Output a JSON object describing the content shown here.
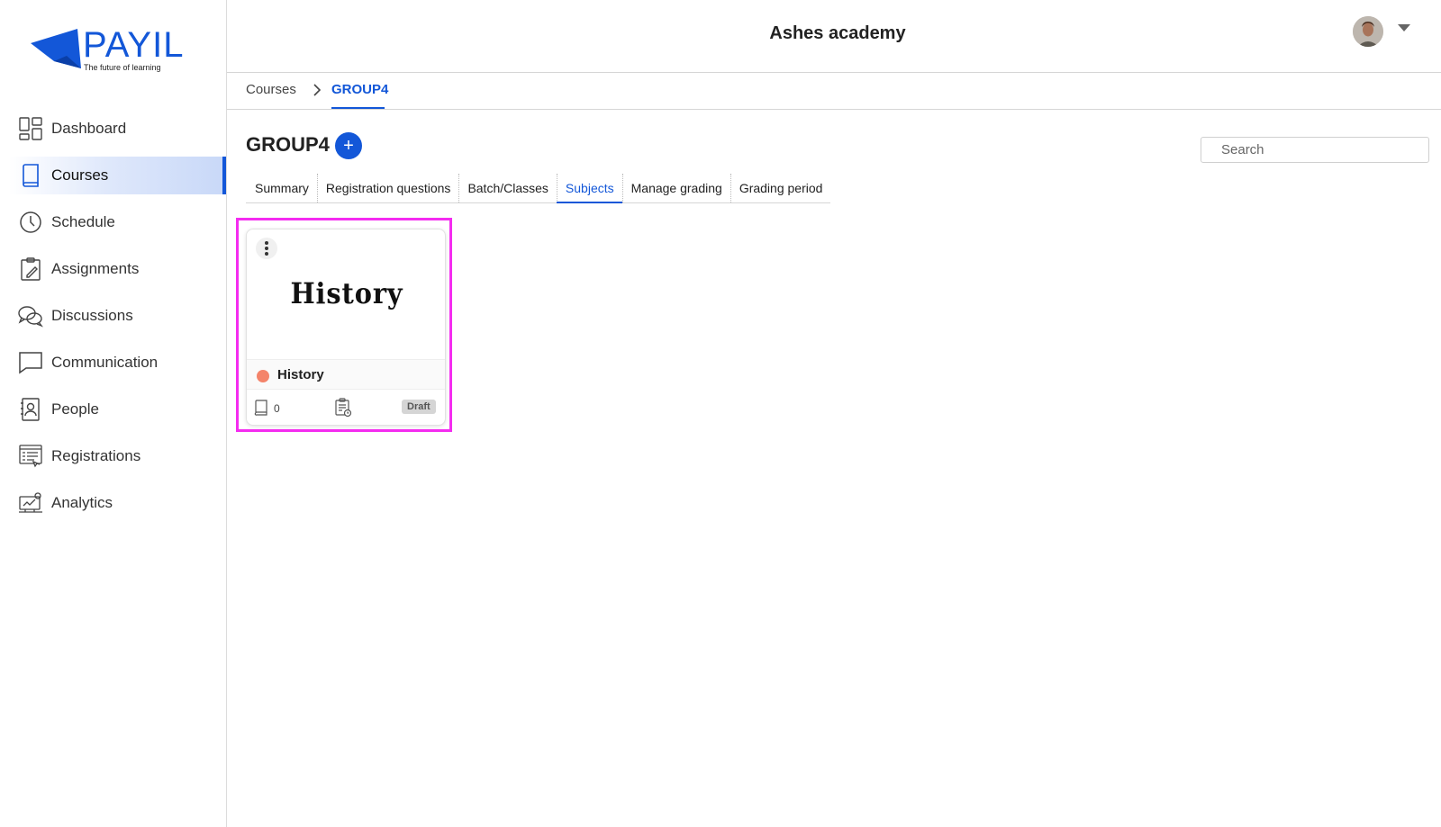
{
  "brand": {
    "name": "PAYIL",
    "tagline": "The future of learning",
    "color": "#1357d8"
  },
  "sidebar": {
    "items": [
      {
        "label": "Dashboard",
        "icon": "dashboard-icon",
        "active": false
      },
      {
        "label": "Courses",
        "icon": "book-icon",
        "active": true
      },
      {
        "label": "Schedule",
        "icon": "clock-icon",
        "active": false
      },
      {
        "label": "Assignments",
        "icon": "clipboard-pencil-icon",
        "active": false
      },
      {
        "label": "Discussions",
        "icon": "chat-bubbles-icon",
        "active": false
      },
      {
        "label": "Communication",
        "icon": "message-square-icon",
        "active": false
      },
      {
        "label": "People",
        "icon": "contact-card-icon",
        "active": false
      },
      {
        "label": "Registrations",
        "icon": "registration-form-icon",
        "active": false
      },
      {
        "label": "Analytics",
        "icon": "analytics-icon",
        "active": false
      }
    ]
  },
  "header": {
    "title": "Ashes academy",
    "avatar_icon": "user-avatar",
    "menu_icon": "caret-down-icon"
  },
  "breadcrumb": {
    "parent": "Courses",
    "current": "GROUP4"
  },
  "page": {
    "title": "GROUP4",
    "add_label": "+",
    "search_placeholder": "Search"
  },
  "tabs": [
    {
      "label": "Summary",
      "active": false
    },
    {
      "label": "Registration questions",
      "active": false
    },
    {
      "label": "Batch/Classes",
      "active": false
    },
    {
      "label": "Subjects",
      "active": true
    },
    {
      "label": "Manage grading",
      "active": false
    },
    {
      "label": "Grading period",
      "active": false
    }
  ],
  "subjects": [
    {
      "thumbnail_text": "History",
      "title": "History",
      "status_color": "#f4846a",
      "lesson_count": "0",
      "status": "Draft"
    }
  ]
}
